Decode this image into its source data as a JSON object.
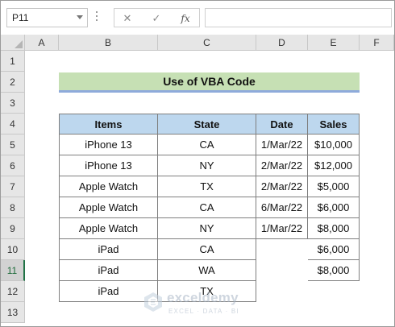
{
  "formula_bar": {
    "name_box": "P11",
    "fx_label": "fx",
    "formula": ""
  },
  "columns": [
    "A",
    "B",
    "C",
    "D",
    "E",
    "F"
  ],
  "rows": [
    "1",
    "2",
    "3",
    "4",
    "5",
    "6",
    "7",
    "8",
    "9",
    "10",
    "11",
    "12",
    "13"
  ],
  "selected_row": "11",
  "title": "Use of VBA Code",
  "table": {
    "headers": [
      "Items",
      "State",
      "Date",
      "Sales"
    ],
    "rows": [
      [
        "iPhone 13",
        "CA",
        "1/Mar/22",
        "$10,000"
      ],
      [
        "iPhone 13",
        "NY",
        "2/Mar/22",
        "$12,000"
      ],
      [
        "Apple Watch",
        "TX",
        "2/Mar/22",
        "$5,000"
      ],
      [
        "Apple Watch",
        "CA",
        "6/Mar/22",
        "$6,000"
      ],
      [
        "Apple Watch",
        "NY",
        "1/Mar/22",
        "$8,000"
      ],
      [
        "iPad",
        "CA",
        "",
        "$6,000"
      ],
      [
        "iPad",
        "WA",
        "",
        "$8,000"
      ],
      [
        "iPad",
        "TX",
        "",
        ""
      ]
    ]
  },
  "watermark": {
    "name": "exceldemy",
    "tagline": "EXCEL · DATA · BI"
  },
  "colors": {
    "title_fill": "#c6e0b4",
    "header_fill": "#bdd7ee",
    "title_underline": "#8eaadb"
  }
}
